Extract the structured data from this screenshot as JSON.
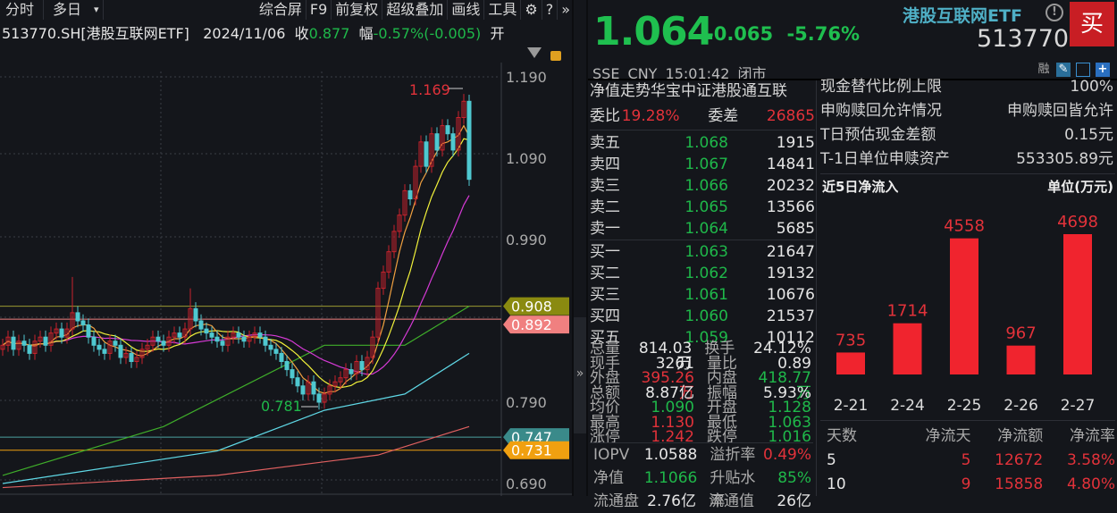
{
  "toolbar": {
    "items": [
      "分时",
      "多日",
      "▾",
      "综合屏",
      "F9",
      "前复权",
      "超级叠加",
      "画线",
      "工具"
    ],
    "gear": "⚙",
    "help": "?",
    "more": "»"
  },
  "infoline": {
    "symbol": "513770.SH[港股互联网ETF]",
    "date": "2024/11/06",
    "close_label": "收",
    "close": "0.877",
    "range_label": "幅",
    "range": "-0.57%(-0.005)",
    "open_label": "开"
  },
  "chart_data": {
    "type": "candlestick",
    "ylim": [
      0.66,
      1.21
    ],
    "yticks": [
      "1.190",
      "1.090",
      "0.990",
      "0.790",
      "0.690"
    ],
    "closes": [
      0.86,
      0.87,
      0.855,
      0.865,
      0.86,
      0.85,
      0.865,
      0.87,
      0.86,
      0.875,
      0.88,
      0.87,
      0.88,
      0.9,
      0.89,
      0.885,
      0.87,
      0.86,
      0.855,
      0.85,
      0.865,
      0.86,
      0.845,
      0.85,
      0.84,
      0.845,
      0.855,
      0.86,
      0.87,
      0.865,
      0.86,
      0.87,
      0.875,
      0.87,
      0.88,
      0.905,
      0.89,
      0.88,
      0.875,
      0.87,
      0.865,
      0.86,
      0.87,
      0.875,
      0.87,
      0.865,
      0.87,
      0.875,
      0.87,
      0.86,
      0.855,
      0.85,
      0.84,
      0.83,
      0.82,
      0.81,
      0.8,
      0.815,
      0.8,
      0.79,
      0.8,
      0.81,
      0.815,
      0.82,
      0.83,
      0.825,
      0.84,
      0.83,
      0.845,
      0.87,
      0.93,
      0.95,
      0.975,
      1.0,
      1.02,
      1.05,
      1.04,
      1.08,
      1.11,
      1.08,
      1.12,
      1.1,
      1.13,
      1.12,
      1.1,
      1.14,
      1.16,
      1.064
    ],
    "max_label": "1.169",
    "min_label": "0.781",
    "long_ma": [
      {
        "name": "MA60",
        "color": "#3fae2a",
        "points": [
          [
            0,
            0.7
          ],
          [
            30,
            0.76
          ],
          [
            60,
            0.86
          ],
          [
            75,
            0.86
          ],
          [
            87,
            0.908
          ]
        ]
      },
      {
        "name": "MA120",
        "color": "#5fd8e6",
        "points": [
          [
            0,
            0.69
          ],
          [
            40,
            0.73
          ],
          [
            60,
            0.78
          ],
          [
            75,
            0.8
          ],
          [
            87,
            0.85
          ]
        ]
      },
      {
        "name": "MA250",
        "color": "#e06060",
        "points": [
          [
            0,
            0.685
          ],
          [
            40,
            0.7
          ],
          [
            70,
            0.725
          ],
          [
            87,
            0.76
          ]
        ]
      }
    ],
    "levels": [
      {
        "value": "0.908",
        "color": "#8a8a10",
        "line": "#9a9a30"
      },
      {
        "value": "0.892",
        "color": "#f08080",
        "line": "#f08080"
      },
      {
        "value": "0.747",
        "color": "#3a8a8a",
        "line": "#4aa0a0"
      },
      {
        "value": "0.731",
        "color": "#f0a010",
        "line": "#f0a010"
      }
    ]
  },
  "quote": {
    "price": "1.064",
    "change": "-0.065",
    "pct": "-5.76%",
    "name": "港股互联网ETF",
    "code": "513770",
    "buy": "买",
    "warn": "!",
    "exchange": "SSE",
    "currency": "CNY",
    "time": "15:01:42",
    "status": "闭市",
    "icons": [
      "融",
      "✎",
      "🔔",
      "+"
    ]
  },
  "orderbook": {
    "title": "净值走势华宝中证港股通互联",
    "ratio_label": "委比",
    "ratio": "19.28%",
    "diff_label": "委差",
    "diff": "26865",
    "sells": [
      {
        "l": "卖五",
        "p": "1.068",
        "v": "1915"
      },
      {
        "l": "卖四",
        "p": "1.067",
        "v": "14841"
      },
      {
        "l": "卖三",
        "p": "1.066",
        "v": "20232"
      },
      {
        "l": "卖二",
        "p": "1.065",
        "v": "13566"
      },
      {
        "l": "卖一",
        "p": "1.064",
        "v": "5685"
      }
    ],
    "buys": [
      {
        "l": "买一",
        "p": "1.063",
        "v": "21647"
      },
      {
        "l": "买二",
        "p": "1.062",
        "v": "19132"
      },
      {
        "l": "买三",
        "p": "1.061",
        "v": "10676"
      },
      {
        "l": "买四",
        "p": "1.060",
        "v": "21537"
      },
      {
        "l": "买五",
        "p": "1.059",
        "v": "10112"
      }
    ]
  },
  "stats": [
    [
      "总量",
      "814.03万",
      "w",
      "换手",
      "24.12%",
      "w"
    ],
    [
      "现手",
      "3261",
      "w",
      "量比",
      "0.89",
      "w"
    ],
    [
      "外盘",
      "395.26万",
      "r",
      "内盘",
      "418.77万",
      "g"
    ],
    [
      "总额",
      "8.87亿",
      "w",
      "振幅",
      "5.93%",
      "w"
    ],
    [
      "均价",
      "1.090",
      "g",
      "开盘",
      "1.128",
      "g"
    ],
    [
      "最高",
      "1.130",
      "r",
      "最低",
      "1.063",
      "g"
    ],
    [
      "涨停",
      "1.242",
      "r",
      "跌停",
      "1.016",
      "g"
    ]
  ],
  "iopv": [
    [
      "IOPV",
      "1.0588",
      "w",
      "溢折率",
      "0.49%",
      "r"
    ],
    [
      "净值",
      "1.1066",
      "g",
      "升贴水率",
      "85%",
      "g"
    ],
    [
      "流通盘",
      "2.76亿",
      "w",
      "流通值",
      "26亿",
      "w"
    ]
  ],
  "etf": [
    [
      "现金替代比例上限",
      "100%"
    ],
    [
      "申购赎回允许情况",
      "申购赎回皆允许"
    ],
    [
      "T日预估现金差额",
      "0.15元"
    ],
    [
      "T-1日单位申赎资产",
      "553305.89元"
    ]
  ],
  "flow": {
    "title": "近5日净流入",
    "unit": "单位(万元)",
    "dates": [
      "2-21",
      "2-24",
      "2-25",
      "2-26",
      "2-27"
    ],
    "values": [
      735,
      1714,
      4558,
      967,
      4698
    ]
  },
  "flowtable": {
    "headers": [
      "天数",
      "净流天",
      "净流额",
      "净流率"
    ],
    "rows": [
      [
        "5",
        "5",
        "12672",
        "3.58%"
      ],
      [
        "10",
        "9",
        "15858",
        "4.80%"
      ]
    ]
  }
}
